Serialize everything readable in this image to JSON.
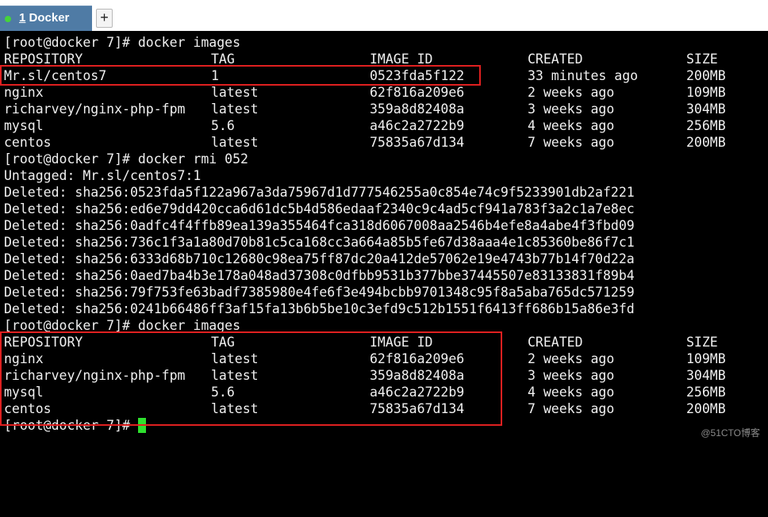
{
  "tab": {
    "number": "1",
    "title": " Docker",
    "new_tab_label": "+"
  },
  "terminal": {
    "prompt_images_1": "[root@docker 7]# docker images",
    "table1": {
      "headers": [
        "REPOSITORY",
        "TAG",
        "IMAGE ID",
        "CREATED",
        "SIZE"
      ],
      "rows": [
        [
          "Mr.sl/centos7",
          "1",
          "0523fda5f122",
          "33 minutes ago",
          "200MB"
        ],
        [
          "nginx",
          "latest",
          "62f816a209e6",
          "2 weeks ago",
          "109MB"
        ],
        [
          "richarvey/nginx-php-fpm",
          "latest",
          "359a8d82408a",
          "3 weeks ago",
          "304MB"
        ],
        [
          "mysql",
          "5.6",
          "a46c2a2722b9",
          "4 weeks ago",
          "256MB"
        ],
        [
          "centos",
          "latest",
          "75835a67d134",
          "7 weeks ago",
          "200MB"
        ]
      ]
    },
    "prompt_rmi": "[root@docker 7]# docker rmi 052",
    "untagged": "Untagged: Mr.sl/centos7:1",
    "deleted": [
      "Deleted: sha256:0523fda5f122a967a3da75967d1d777546255a0c854e74c9f5233901db2af221",
      "Deleted: sha256:ed6e79dd420cca6d61dc5b4d586edaaf2340c9c4ad5cf941a783f3a2c1a7e8ec",
      "Deleted: sha256:0adfc4f4ffb89ea139a355464fca318d6067008aa2546b4efe8a4abe4f3fbd09",
      "Deleted: sha256:736c1f3a1a80d70b81c5ca168cc3a664a85b5fe67d38aaa4e1c85360be86f7c1",
      "Deleted: sha256:6333d68b710c12680c98ea75ff87dc20a412de57062e19e4743b77b14f70d22a",
      "Deleted: sha256:0aed7ba4b3e178a048ad37308c0dfbb9531b377bbe37445507e83133831f89b4",
      "Deleted: sha256:79f753fe63badf7385980e4fe6f3e494bcbb9701348c95f8a5aba765dc571259",
      "Deleted: sha256:0241b66486ff3af15fa13b6b5be10c3efd9c512b1551f6413ff686b15a86e3fd"
    ],
    "prompt_images_2": "[root@docker 7]# docker images",
    "table2": {
      "headers": [
        "REPOSITORY",
        "TAG",
        "IMAGE ID",
        "CREATED",
        "SIZE"
      ],
      "rows": [
        [
          "nginx",
          "latest",
          "62f816a209e6",
          "2 weeks ago",
          "109MB"
        ],
        [
          "richarvey/nginx-php-fpm",
          "latest",
          "359a8d82408a",
          "3 weeks ago",
          "304MB"
        ],
        [
          "mysql",
          "5.6",
          "a46c2a2722b9",
          "4 weeks ago",
          "256MB"
        ],
        [
          "centos",
          "latest",
          "75835a67d134",
          "7 weeks ago",
          "200MB"
        ]
      ]
    },
    "final_prompt": "[root@docker 7]# "
  },
  "colors": {
    "tab_background": "#4f7ba5",
    "terminal_background": "#000000",
    "terminal_text": "#f0f0f0",
    "cursor": "#2ee02e",
    "highlight_box": "#e02020"
  },
  "watermark": "@51CTO博客"
}
